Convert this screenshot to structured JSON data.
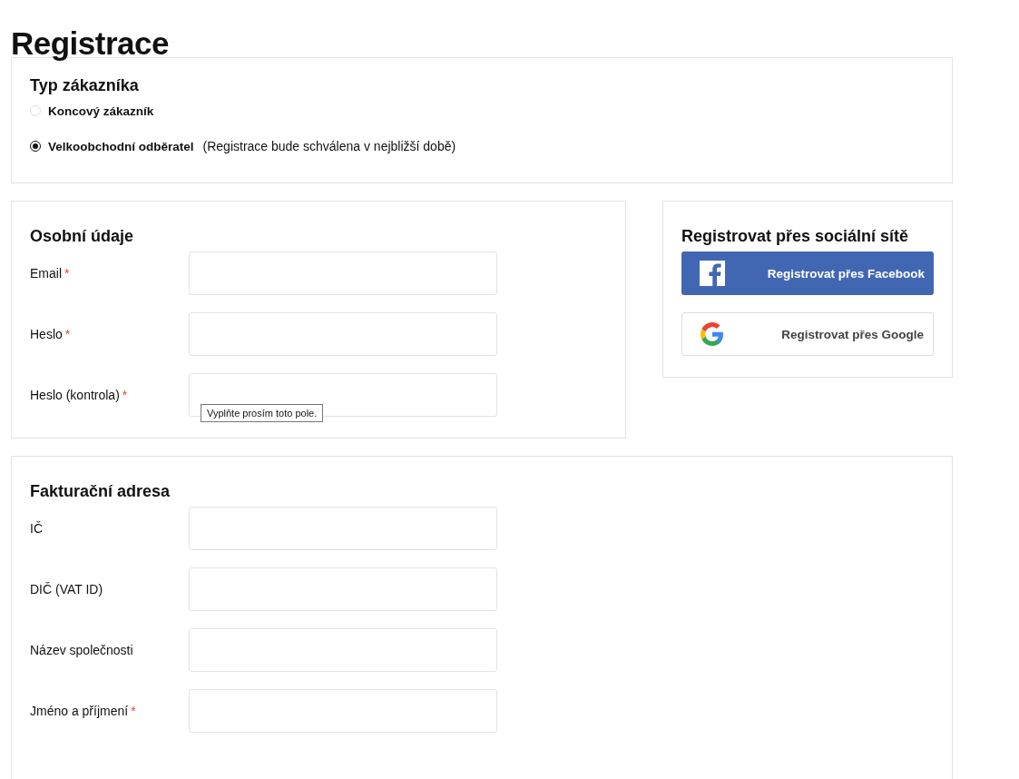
{
  "page_title": "Registrace",
  "customer_type": {
    "heading": "Typ zákazníka",
    "options": [
      {
        "label": "Koncový zákazník",
        "selected": false
      },
      {
        "label": "Velkoobchodní odběratel",
        "note": "(Registrace bude schválena v nejbližší době)",
        "selected": true
      }
    ]
  },
  "personal": {
    "heading": "Osobní údaje",
    "fields": [
      {
        "label": "Email",
        "marker": "*"
      },
      {
        "label": "Heslo",
        "marker": "*"
      },
      {
        "label": "Heslo (kontrola)",
        "marker": "*",
        "tooltip": "Vyplňte prosím toto pole."
      }
    ]
  },
  "social": {
    "heading": "Registrovat přes sociální sítě",
    "buttons": [
      {
        "kind": "facebook",
        "label": "Registrovat přes Facebook"
      },
      {
        "kind": "google",
        "label": "Registrovat přes Google"
      }
    ]
  },
  "billing": {
    "heading": "Fakturační adresa",
    "fields": [
      {
        "label": "IČ"
      },
      {
        "label": "DIČ (VAT ID)"
      },
      {
        "label": "Název společnosti"
      },
      {
        "label": "Jméno a příjmení",
        "marker": "*"
      }
    ]
  }
}
